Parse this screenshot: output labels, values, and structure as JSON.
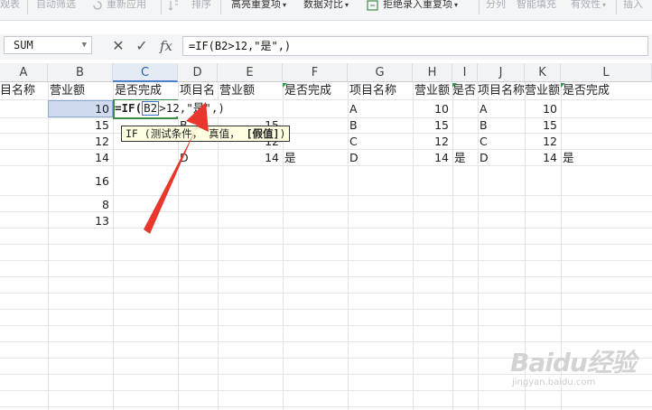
{
  "toolbar": {
    "items": [
      "观表",
      "自动筛选",
      "重新应用",
      "排序",
      "高亮重复项",
      "数据对比",
      "拒绝录入重复项",
      "分列",
      "智能填充",
      "有效性",
      "插入"
    ]
  },
  "formula_bar": {
    "name_box": "SUM",
    "cancel": "✕",
    "confirm": "✓",
    "fx": "fx",
    "formula": "=IF(B2>12,\"是\",)"
  },
  "columns": [
    "A",
    "B",
    "C",
    "D",
    "E",
    "F",
    "G",
    "H",
    "I",
    "J",
    "K",
    "L"
  ],
  "active_column": "C",
  "header_row": {
    "a": "目名称",
    "b": "营业额",
    "c": "是否完成",
    "d": "项目名",
    "e": "营业额",
    "f": "是否完成",
    "g": "项目名称",
    "h": "营业额",
    "i": "是否",
    "j": "项目名称",
    "k": "营业额",
    "l": "是否完成"
  },
  "editing": {
    "part1": "=IF(",
    "ref": "B2",
    "part2": ">12,\"是\",)"
  },
  "tooltip": {
    "prefix": "IF (",
    "arg1": "测试条件",
    "sep1": "， ",
    "arg2": "真值",
    "sep2": "， ",
    "arg3": "[假值]",
    "suffix": ")"
  },
  "rows": {
    "b": [
      "10",
      "15",
      "12",
      "14",
      "16",
      "8",
      "13"
    ],
    "d": [
      "",
      "B",
      "",
      "D"
    ],
    "e": [
      "",
      "15",
      "12",
      "14"
    ],
    "f": [
      "",
      "",
      "",
      "是"
    ],
    "g": [
      "A",
      "B",
      "C",
      "D"
    ],
    "h": [
      "10",
      "15",
      "12",
      "14"
    ],
    "i": [
      "",
      "",
      "",
      "是"
    ],
    "j": [
      "A",
      "B",
      "C",
      "D"
    ],
    "k": [
      "10",
      "15",
      "12",
      "14"
    ],
    "l": [
      "",
      "",
      "",
      "是"
    ]
  },
  "watermark": {
    "main": "Baidu经验",
    "sub": "jingyan.baidu.com"
  },
  "colors": {
    "accent_green": "#3f8c4a",
    "selection_blue": "#cfdcef",
    "arrow_red": "#e8382e"
  }
}
